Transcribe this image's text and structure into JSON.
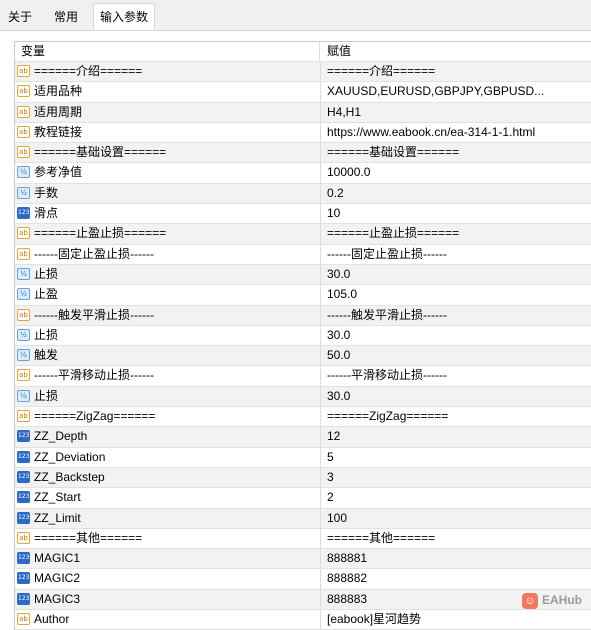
{
  "tabs": [
    "关于",
    "常用",
    "输入参数"
  ],
  "columns": {
    "name": "变量",
    "value": "赋值"
  },
  "rows": [
    {
      "type": "ab",
      "icon": "string-type-icon",
      "name": "======介绍======",
      "value": "======介绍======"
    },
    {
      "type": "ab",
      "icon": "string-type-icon",
      "name": "适用品种",
      "value": "XAUUSD,EURUSD,GBPJPY,GBPUSD..."
    },
    {
      "type": "ab",
      "icon": "string-type-icon",
      "name": "适用周期",
      "value": "H4,H1"
    },
    {
      "type": "ab",
      "icon": "string-type-icon",
      "name": "教程链接",
      "value": "https://www.eabook.cn/ea-314-1-1.html"
    },
    {
      "type": "ab",
      "icon": "string-type-icon",
      "name": "======基础设置======",
      "value": "======基础设置======"
    },
    {
      "type": "v2",
      "icon": "double-type-icon",
      "name": "参考净值",
      "value": "10000.0"
    },
    {
      "type": "v2",
      "icon": "double-type-icon",
      "name": "手数",
      "value": "0.2"
    },
    {
      "type": "123",
      "icon": "integer-type-icon",
      "name": "滑点",
      "value": "10"
    },
    {
      "type": "ab",
      "icon": "string-type-icon",
      "name": "======止盈止损======",
      "value": "======止盈止损======"
    },
    {
      "type": "ab",
      "icon": "string-type-icon",
      "name": "------固定止盈止损------",
      "value": "------固定止盈止损------"
    },
    {
      "type": "v2",
      "icon": "double-type-icon",
      "name": "止损",
      "value": "30.0"
    },
    {
      "type": "v2",
      "icon": "double-type-icon",
      "name": "止盈",
      "value": "105.0"
    },
    {
      "type": "ab",
      "icon": "string-type-icon",
      "name": "------触发平滑止损------",
      "value": "------触发平滑止损------"
    },
    {
      "type": "v2",
      "icon": "double-type-icon",
      "name": "止损",
      "value": "30.0"
    },
    {
      "type": "v2",
      "icon": "double-type-icon",
      "name": "触发",
      "value": "50.0"
    },
    {
      "type": "ab",
      "icon": "string-type-icon",
      "name": "------平滑移动止损------",
      "value": "------平滑移动止损------"
    },
    {
      "type": "v2",
      "icon": "double-type-icon",
      "name": "止损",
      "value": "30.0"
    },
    {
      "type": "ab",
      "icon": "string-type-icon",
      "name": "======ZigZag======",
      "value": "======ZigZag======"
    },
    {
      "type": "123",
      "icon": "integer-type-icon",
      "name": "ZZ_Depth",
      "value": "12"
    },
    {
      "type": "123",
      "icon": "integer-type-icon",
      "name": "ZZ_Deviation",
      "value": "5"
    },
    {
      "type": "123",
      "icon": "integer-type-icon",
      "name": "ZZ_Backstep",
      "value": "3"
    },
    {
      "type": "123",
      "icon": "integer-type-icon",
      "name": "ZZ_Start",
      "value": "2"
    },
    {
      "type": "123",
      "icon": "integer-type-icon",
      "name": "ZZ_Limit",
      "value": "100"
    },
    {
      "type": "ab",
      "icon": "string-type-icon",
      "name": "======其他======",
      "value": "======其他======"
    },
    {
      "type": "123",
      "icon": "integer-type-icon",
      "name": "MAGIC1",
      "value": "888881"
    },
    {
      "type": "123",
      "icon": "integer-type-icon",
      "name": "MAGIC2",
      "value": "888882"
    },
    {
      "type": "123",
      "icon": "integer-type-icon",
      "name": "MAGIC3",
      "value": "888883"
    },
    {
      "type": "ab",
      "icon": "string-type-icon",
      "name": "Author",
      "value": "[eabook]星河趋势"
    }
  ],
  "watermark": {
    "text": "EAHub",
    "icon": "eahub-logo-icon"
  },
  "colors": {
    "alt_row": "#f2f2f2",
    "grid_line": "#e2e2e2",
    "icon_blue": "#2e69c2",
    "icon_string": "#e0a640"
  }
}
